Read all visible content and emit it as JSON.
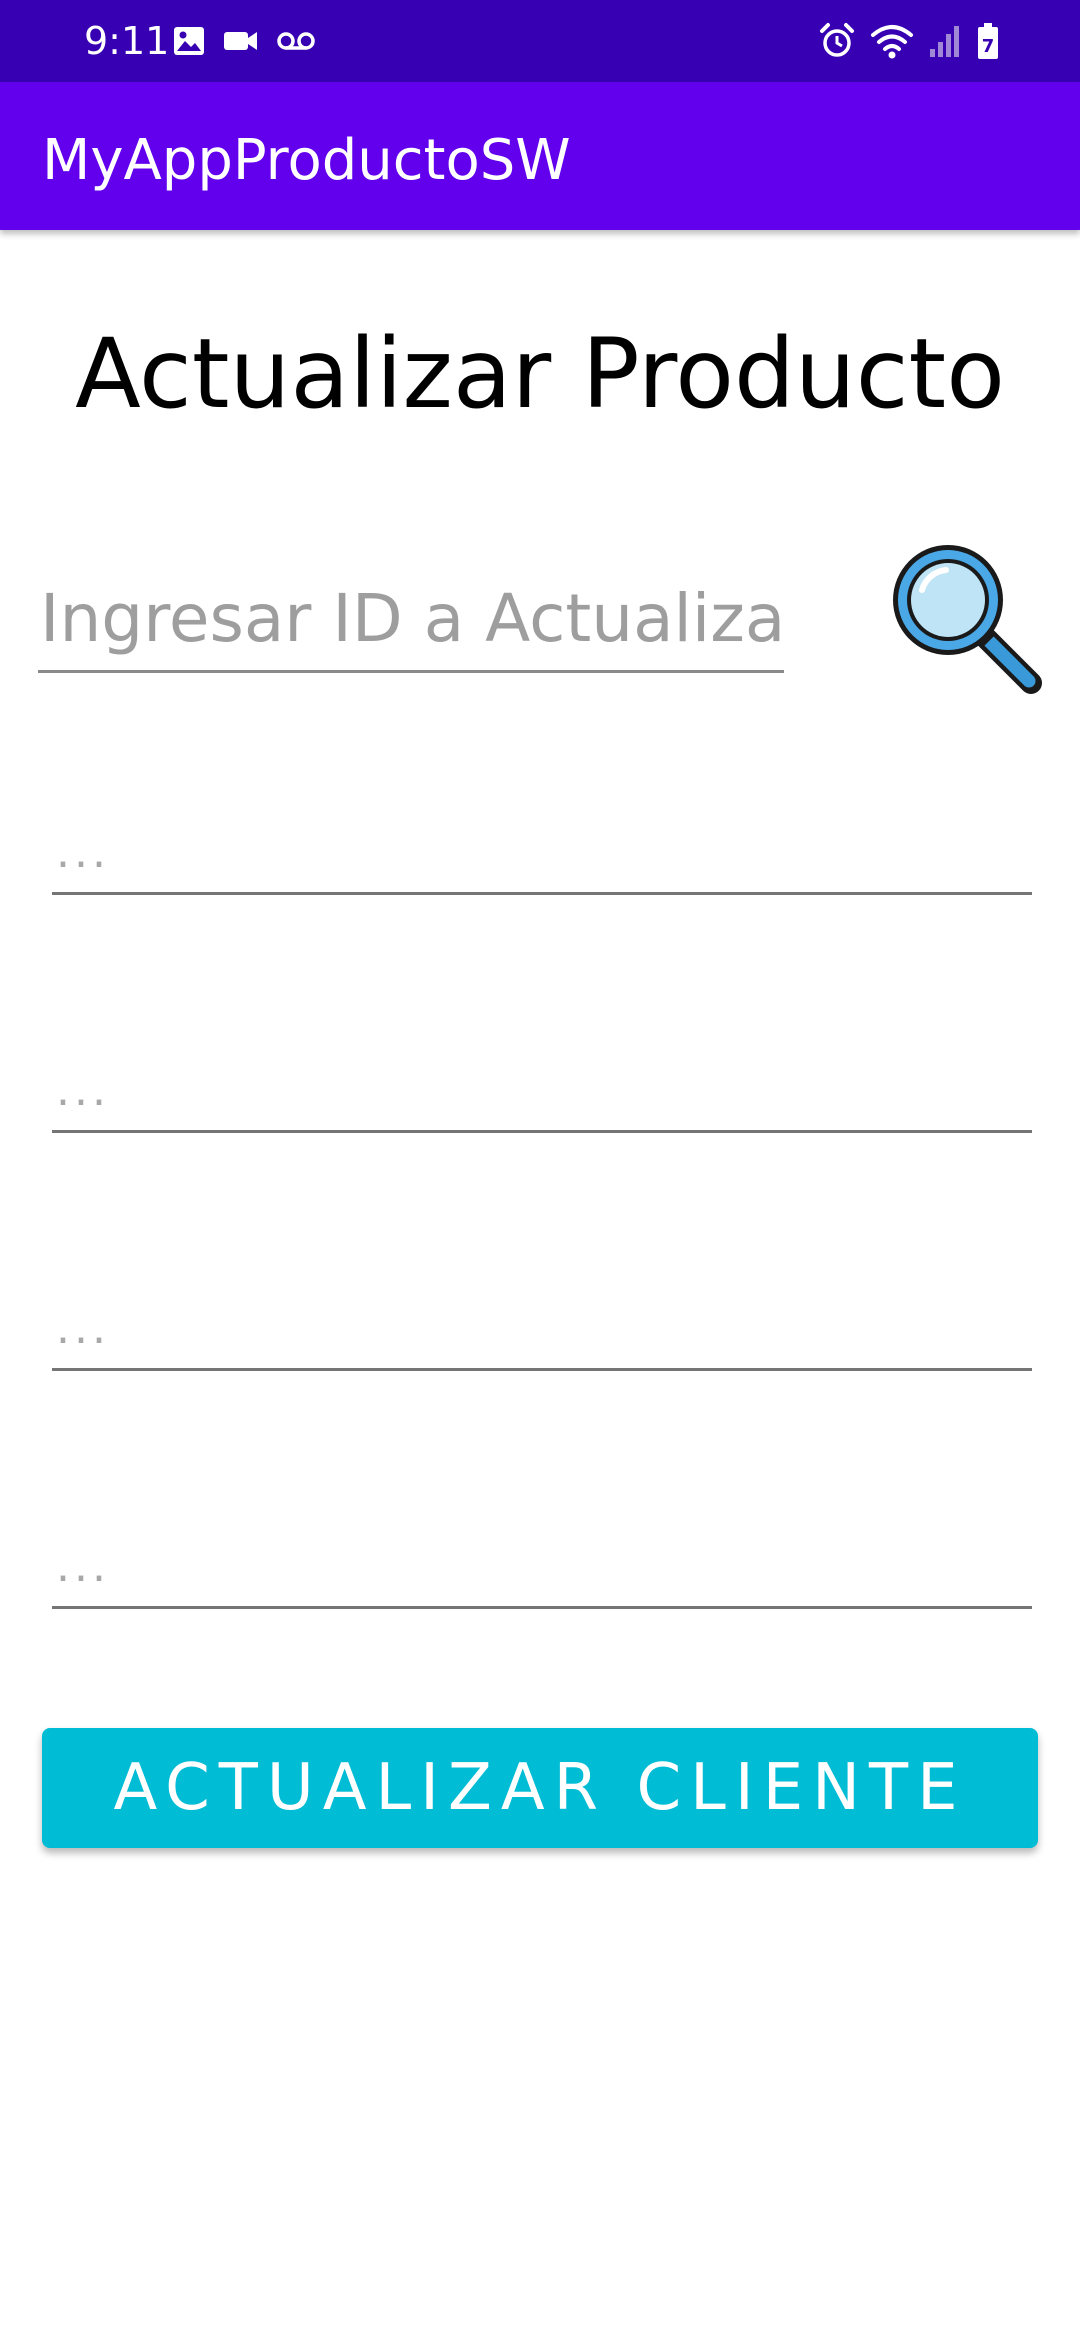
{
  "status_bar": {
    "time": "9:11",
    "left_icons": [
      "image-icon",
      "video-camera-icon",
      "voicemail-icon"
    ],
    "right_icons": [
      "alarm-icon",
      "wifi-icon",
      "signal-icon",
      "battery-icon"
    ],
    "background": "#3700b3"
  },
  "app_bar": {
    "title": "MyAppProductoSW",
    "background": "#6200ee"
  },
  "main": {
    "title": "Actualizar Producto",
    "id_input": {
      "placeholder": "Ingresar ID a Actualizar",
      "value": ""
    },
    "search_button_icon": "magnifying-glass-icon",
    "fields": [
      {
        "placeholder": "...",
        "value": ""
      },
      {
        "placeholder": "...",
        "value": ""
      },
      {
        "placeholder": "...",
        "value": ""
      },
      {
        "placeholder": "...",
        "value": ""
      }
    ],
    "submit_label": "ACTUALIZAR CLIENTE",
    "accent": "#00bcd4"
  }
}
